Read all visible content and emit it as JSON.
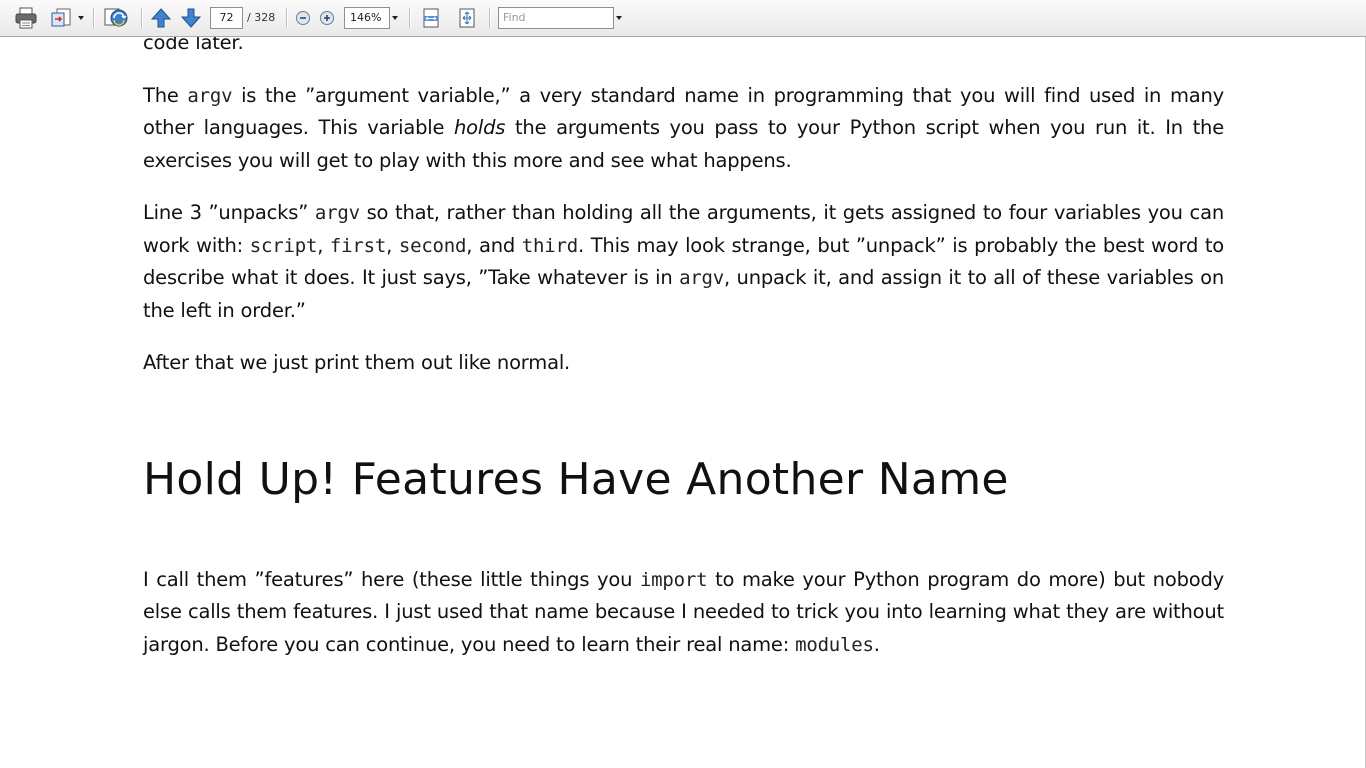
{
  "toolbar": {
    "page_current": "72",
    "page_total": "/ 328",
    "zoom": "146%",
    "find_placeholder": "Find",
    "icons": [
      "printer-icon",
      "export-icon",
      "collaborate-icon",
      "previous-page-icon",
      "next-page-icon",
      "zoom-out-icon",
      "zoom-in-icon",
      "fit-width-icon",
      "fit-page-icon"
    ]
  },
  "document": {
    "p0": "code later.",
    "p1": {
      "a": "The ",
      "code1": "argv",
      "b": " is the ”argument variable,” a very standard name in programming that you will find used in many other languages. This variable ",
      "em": "holds",
      "c": " the arguments you pass to your Python script when you run it. In the exercises you will get to play with this more and see what happens."
    },
    "p2": {
      "a": "Line 3 ”unpacks” ",
      "code1": "argv",
      "b": " so that, rather than holding all the arguments, it gets assigned to four variables you can work with: ",
      "code2": "script",
      "c": ", ",
      "code3": "first",
      "d": ", ",
      "code4": "second",
      "e": ", and ",
      "code5": "third",
      "f": ". This may look strange, but ”unpack” is probably the best word to describe what it does. It just says, ”Take whatever is in ",
      "code6": "argv",
      "g": ", unpack it, and assign it to all of these variables on the left in order.”"
    },
    "p3": "After that we just print them out like normal.",
    "heading": "Hold Up! Features Have Another Name",
    "p4": {
      "a": "I call them ”features” here (these little things you ",
      "code1": "import",
      "b": " to make your Python program do more) but nobody else calls them features. I just used that name because I needed to trick you into learning what they are without jargon. Before you can continue, you need to learn their real name: ",
      "code2": "modules",
      "c": "."
    }
  }
}
